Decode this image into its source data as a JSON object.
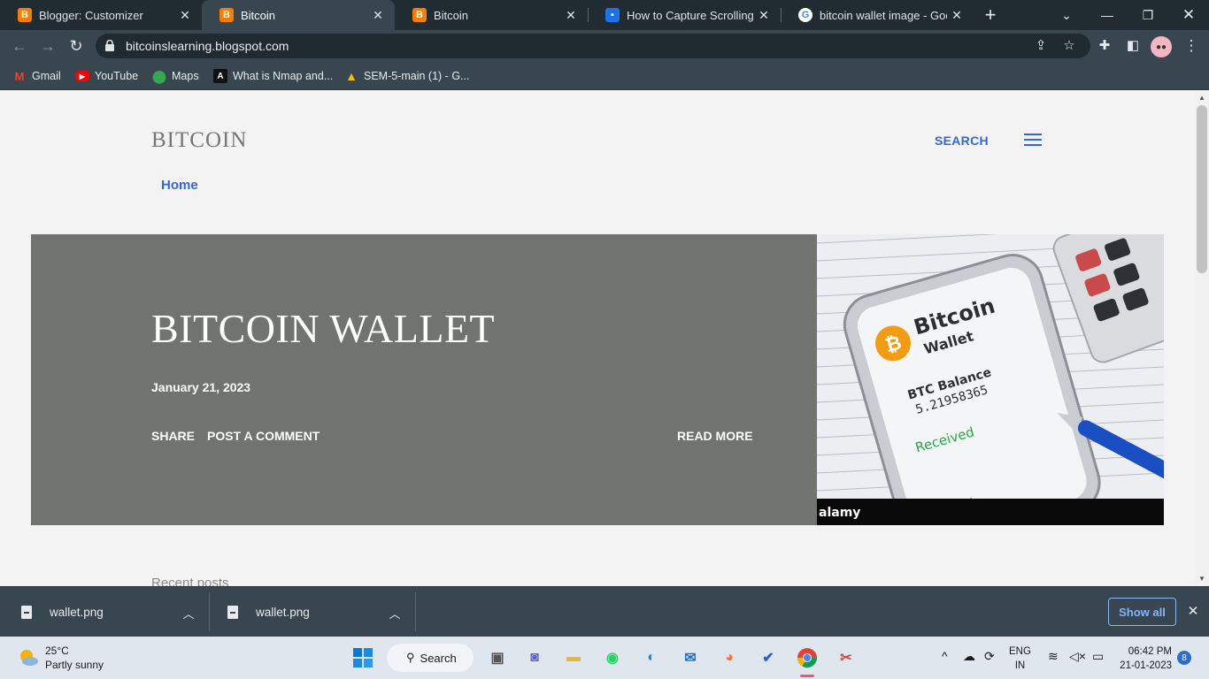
{
  "tabs": [
    {
      "title": "Blogger: Customizer",
      "icon": "blogger-icon",
      "active": false
    },
    {
      "title": "Bitcoin",
      "icon": "blogger-icon",
      "active": true
    },
    {
      "title": "Bitcoin",
      "icon": "blogger-icon",
      "active": false
    },
    {
      "title": "How to Capture Scrolling Scr",
      "icon": "microsoft-icon",
      "active": false
    },
    {
      "title": "bitcoin wallet image - Googl",
      "icon": "google-icon",
      "active": false
    }
  ],
  "address": {
    "url": "bitcoinslearning.blogspot.com"
  },
  "bookmarks": [
    {
      "label": "Gmail",
      "icon": "gmail-icon"
    },
    {
      "label": "YouTube",
      "icon": "youtube-icon"
    },
    {
      "label": "Maps",
      "icon": "maps-icon"
    },
    {
      "label": "What is Nmap and...",
      "icon": "nmap-icon"
    },
    {
      "label": "SEM-5-main (1) - G...",
      "icon": "drive-icon"
    }
  ],
  "page": {
    "site_title": "BITCOIN",
    "search_label": "SEARCH",
    "nav_home": "Home",
    "post": {
      "title": "BITCOIN WALLET",
      "date": "January 21, 2023",
      "share": "SHARE",
      "comment": "POST A COMMENT",
      "read_more": "READ MORE"
    },
    "image": {
      "brand": "Bitcoin",
      "sub": "Wallet",
      "balance_label": "BTC Balance",
      "balance": "5.21958365",
      "received": "Received",
      "sent": "Sent",
      "watermark": "alamy"
    },
    "recent_posts": "Recent posts"
  },
  "downloads": {
    "items": [
      {
        "name": "wallet.png"
      },
      {
        "name": "wallet.png"
      }
    ],
    "show_all": "Show all"
  },
  "taskbar": {
    "weather_temp": "25°C",
    "weather_desc": "Partly sunny",
    "search": "Search",
    "lang_line1": "ENG",
    "lang_line2": "IN",
    "time": "06:42 PM",
    "date": "21-01-2023",
    "notifications": "8"
  },
  "colors": {
    "accent": "#3367d6",
    "hero_bg": "#707370",
    "chrome_dark": "#212b32",
    "chrome_toolbar": "#38474f"
  }
}
